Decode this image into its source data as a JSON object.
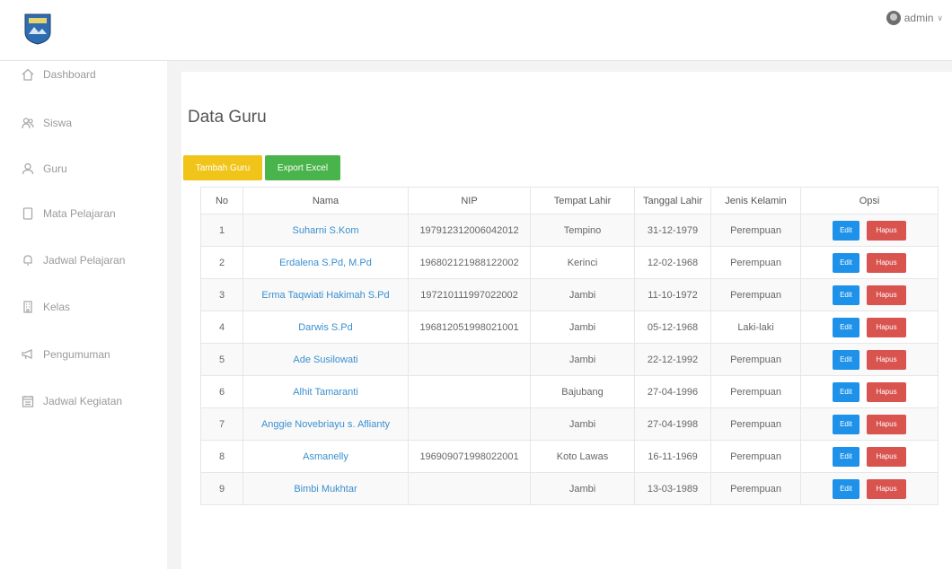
{
  "header": {
    "user": "admin"
  },
  "sidebar": {
    "items": [
      {
        "label": "Dashboard",
        "icon": "home-icon"
      },
      {
        "label": "Siswa",
        "icon": "users-icon"
      },
      {
        "label": "Guru",
        "icon": "user-icon"
      },
      {
        "label": "Mata Pelajaran",
        "icon": "book-icon"
      },
      {
        "label": "Jadwal Pelajaran",
        "icon": "bell-icon"
      },
      {
        "label": "Kelas",
        "icon": "building-icon"
      },
      {
        "label": "Pengumuman",
        "icon": "megaphone-icon"
      },
      {
        "label": "Jadwal Kegiatan",
        "icon": "calendar-icon"
      }
    ]
  },
  "main": {
    "title": "Data Guru",
    "add_button": "Tambah Guru",
    "export_button": "Export Excel",
    "table": {
      "headers": [
        "No",
        "Nama",
        "NIP",
        "Tempat Lahir",
        "Tanggal Lahir",
        "Jenis Kelamin",
        "Opsi"
      ],
      "edit_label": "Edit",
      "delete_label": "Hapus",
      "rows": [
        {
          "no": "1",
          "nama": "Suharni S.Kom",
          "nip": "197912312006042012",
          "tempat": "Tempino",
          "tanggal": "31-12-1979",
          "jk": "Perempuan"
        },
        {
          "no": "2",
          "nama": "Erdalena S.Pd, M.Pd",
          "nip": "196802121988122002",
          "tempat": "Kerinci",
          "tanggal": "12-02-1968",
          "jk": "Perempuan"
        },
        {
          "no": "3",
          "nama": "Erma Taqwiati Hakimah S.Pd",
          "nip": "197210111997022002",
          "tempat": "Jambi",
          "tanggal": "11-10-1972",
          "jk": "Perempuan"
        },
        {
          "no": "4",
          "nama": "Darwis S.Pd",
          "nip": "196812051998021001",
          "tempat": "Jambi",
          "tanggal": "05-12-1968",
          "jk": "Laki-laki"
        },
        {
          "no": "5",
          "nama": "Ade Susilowati",
          "nip": "",
          "tempat": "Jambi",
          "tanggal": "22-12-1992",
          "jk": "Perempuan"
        },
        {
          "no": "6",
          "nama": "Alhit Tamaranti",
          "nip": "",
          "tempat": "Bajubang",
          "tanggal": "27-04-1996",
          "jk": "Perempuan"
        },
        {
          "no": "7",
          "nama": "Anggie Novebriayu s. Aflianty",
          "nip": "",
          "tempat": "Jambi",
          "tanggal": "27-04-1998",
          "jk": "Perempuan"
        },
        {
          "no": "8",
          "nama": "Asmanelly",
          "nip": "196909071998022001",
          "tempat": "Koto Lawas",
          "tanggal": "16-11-1969",
          "jk": "Perempuan"
        },
        {
          "no": "9",
          "nama": "Bimbi Mukhtar",
          "nip": "",
          "tempat": "Jambi",
          "tanggal": "13-03-1989",
          "jk": "Perempuan"
        }
      ]
    }
  },
  "colors": {
    "add": "#f0c419",
    "export": "#49b44b",
    "edit": "#1d92e8",
    "delete": "#d9534f",
    "link": "#3a8fd0"
  }
}
